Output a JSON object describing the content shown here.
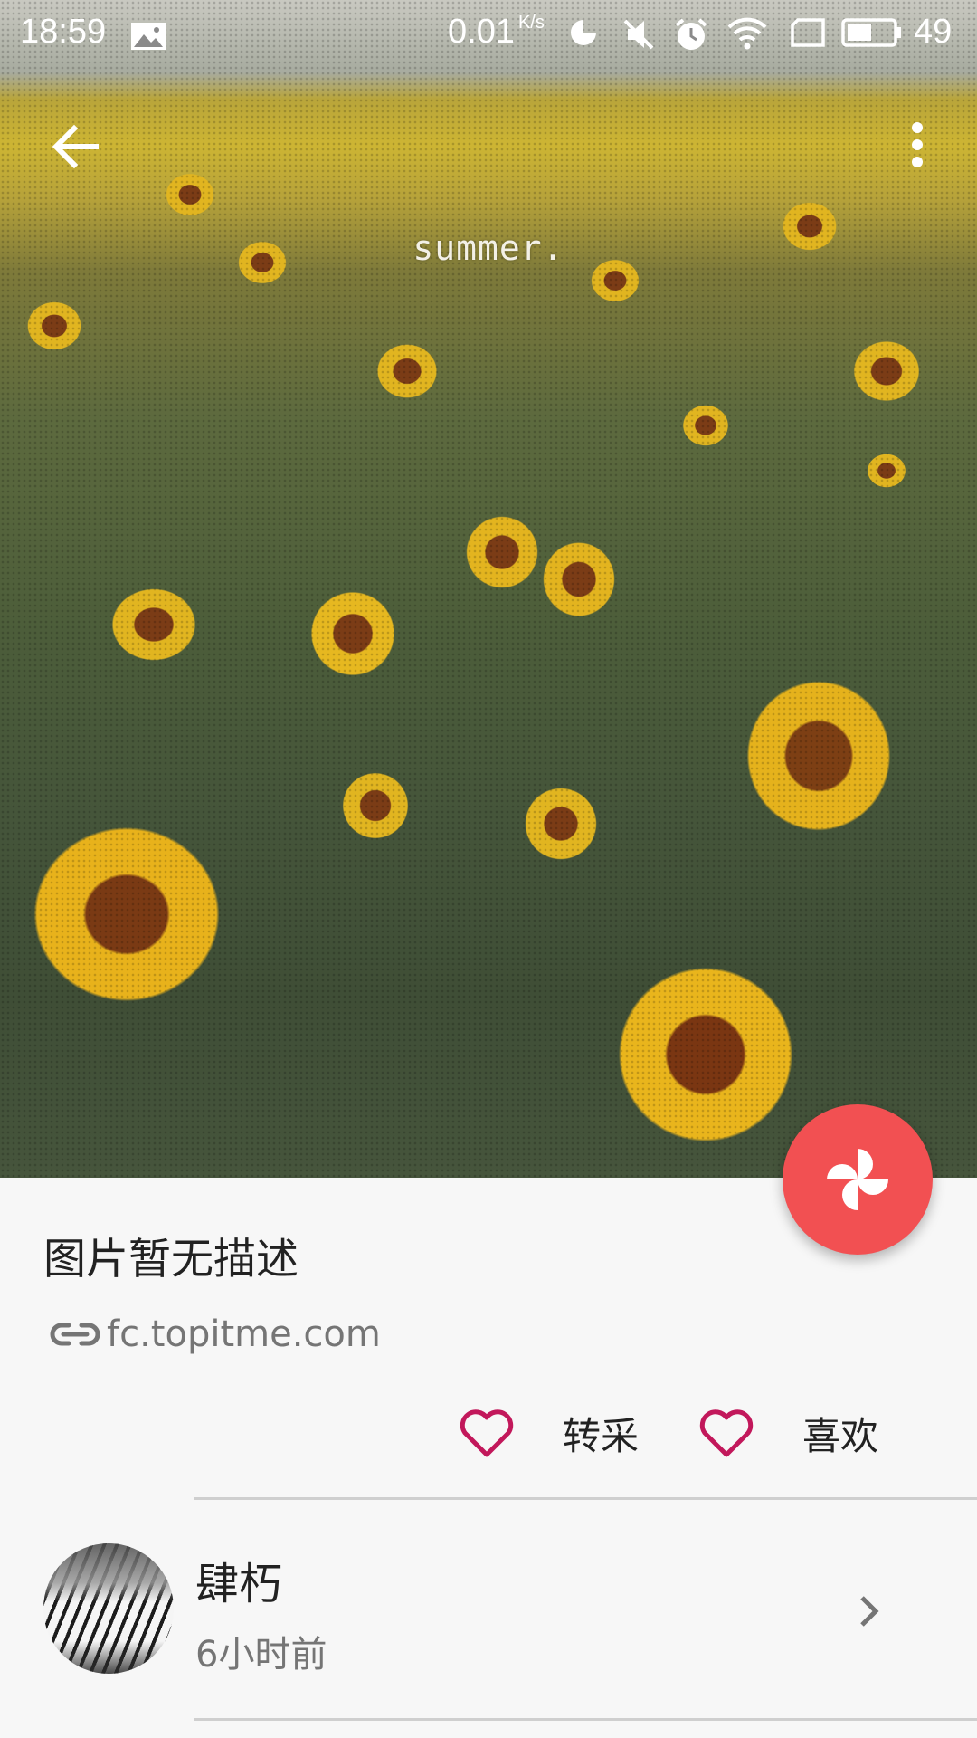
{
  "status_bar": {
    "time": "18:59",
    "net_speed": "0.01",
    "net_speed_unit": "K/s",
    "battery": "49",
    "icons": [
      "image-icon",
      "data-saver-icon",
      "mute-icon",
      "alarm-icon",
      "wifi-icon",
      "sim-icon",
      "battery-icon"
    ]
  },
  "toolbar": {
    "back_icon": "arrow-left-icon",
    "more_icon": "more-vert-icon"
  },
  "image": {
    "caption": "summer."
  },
  "fab": {
    "icon": "pinwheel-icon",
    "color": "#f25052"
  },
  "detail": {
    "description": "图片暂无描述",
    "source": "fc.topitme.com",
    "source_icon": "link-icon"
  },
  "actions": [
    {
      "label": "转采",
      "icon": "heart-outline-icon"
    },
    {
      "label": "喜欢",
      "icon": "heart-outline-icon"
    }
  ],
  "accent_color": "#c2185b",
  "user": {
    "name": "肆朽",
    "time": "6小时前",
    "avatar_icon": "avatar"
  }
}
